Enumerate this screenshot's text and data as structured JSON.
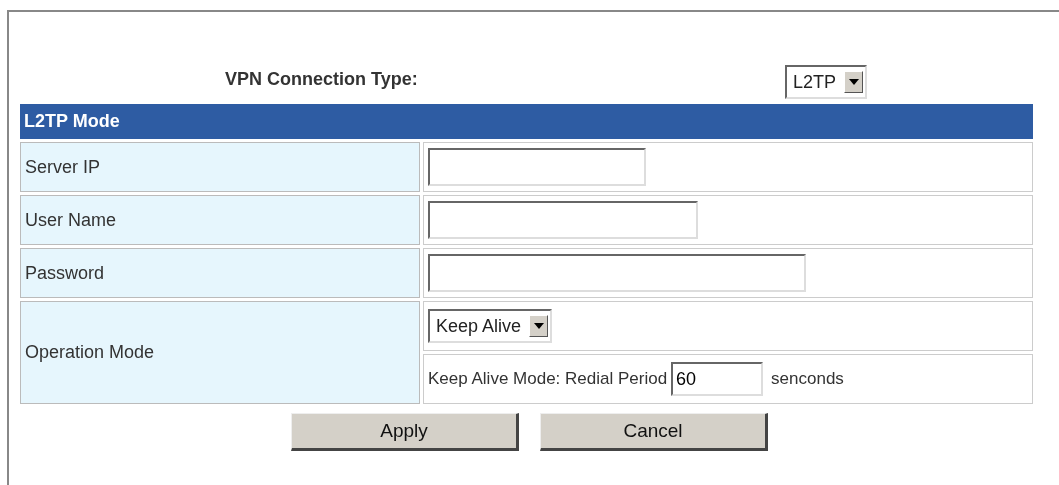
{
  "vpn_connection_type": {
    "label": "VPN Connection Type:",
    "value": "L2TP"
  },
  "section": {
    "title": "L2TP Mode"
  },
  "fields": [
    {
      "label": "Server IP"
    },
    {
      "label": "User Name"
    },
    {
      "label": "Password"
    }
  ],
  "operation_mode": {
    "label": "Operation Mode",
    "value": "Keep Alive",
    "redial_label": "Keep Alive Mode: Redial Period",
    "redial_value": "60",
    "redial_unit": "senconds"
  },
  "buttons": [
    "Apply",
    "Cancel"
  ]
}
